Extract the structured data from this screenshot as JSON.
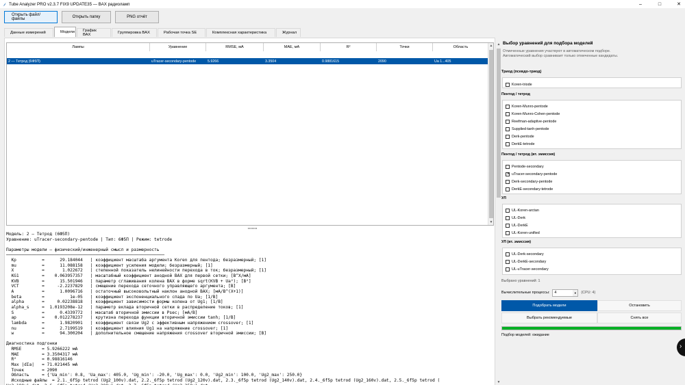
{
  "window": {
    "title": "Tube Analyzer PRO v2.3.7 FIX9 UPDATE35 — ВАХ радиоламп",
    "controls": [
      "–",
      "□",
      "✕"
    ]
  },
  "toolbar": {
    "open_files": "Открыть файл/файлы",
    "open_folder": "Открыть папку",
    "png_report": "PNG отчёт"
  },
  "tabs": [
    "Данные измерений",
    "Модели",
    "График ВАХ",
    "Группировка ВАХ",
    "Рабочая точка SE",
    "Комплексная характеристика",
    "Журнал"
  ],
  "table": {
    "columns": [
      "Лампы",
      "Уравнение",
      "RMSE, мА",
      "MAE, мА",
      "R²",
      "Точки",
      "Область"
    ],
    "rows": [
      [
        "2 — Тетрод (6Ф5П)",
        "uTracer-secondary-pentode",
        "5.9266",
        "3.3504",
        "0.9881615",
        "2090",
        "Ua 1...405"
      ]
    ]
  },
  "details": {
    "lines": [
      "Модель: 2 — Тетрод (6Ф5П)",
      "Уравнение: uTracer-secondary-pentode | Тип: 6Ф5П | Режим: tetrode",
      "",
      "Параметры модели — физический/инженерный смысл и размерность",
      "──────────────────────────────────────────────────────────────",
      "  Kp          =      29.184044   | коэффициент масштаба аргумента Koren для пентода; безразмерный; [1]",
      "  mu          =      11.088158   | коэффициент усиления модели; безразмерный; [1]",
      "  X           =       1.022672   | степенной показатель нелинейности перехода в ток; безразмерный; [1]",
      "  KG1         =    0.063957357   | масштабный коэффициент анодной ВАХ для первой сетки; [B^X/мА]",
      "  KVB         =      15.501946   | параметр сглаживания колена ВАХ в форме sqrt(KVB + Ua²); [B²]",
      "  VCT         =     -2.2237829   | смещение перехода сеточного управляющего аргумента; [B]",
      "  A           =      1.0096716   | остаточный высоковольтный наклон анодной ВАХ; [мА/B^(X+1)]",
      "  beta        =          1e-05   | коэффициент экспоненциального спада по Ua; [1/B]",
      "  alpha       =     0.02238818   | коэффициент зависимости формы колена от Ug1; [1/B]",
      "  alpha_s     =  1.0193208e-12   | параметр вклада вторичной сетки в распределение токов; [1]",
      "  S           =      0.4339772   | масштаб вторичной эмиссии в Psec; [мА/B]",
      "  ap          =    0.012278237   | крутизна перехода функции вторичной эмиссии tanh; [1/B]",
      "  lambda      =      1.9820901   | коэффициент связи Ug2 с эффективным напряжением crossover; [1]",
      "  nu          =      2.7199519   | коэффициент влияния Ug1 на напряжение crossover; [1]",
      "  w           =      94.300204   | дополнительное смещение напряжения crossover вторичной эмиссии; [B]",
      "",
      "Диагностика подгонки",
      "  RMSE        = 5.9266222 мА",
      "  MAE         = 3.3504317 мА",
      "  R²          = 0.98816146",
      "  Max |dIa|   = 71.021445 мА",
      "  Точек       = 2090",
      "  Область     = {'Ua_min': 0.8, 'Ua_max': 405.0, 'Ug_min': -20.0, 'Ug_max': 0.0, 'Ug2_min': 100.0, 'Ug2_max': 250.0}",
      "  Исходные файлы  = 2.1._6f5p tetrod (Ug2_100v).dat, 2.2._6f5p tetrod (Ug2_120v).dat, 2.3._6f5p tetrod (Ug2_140v).dat, 2.4._6f5p tetrod (Ug2_160v).dat, 2.5._6f5p tetrod (",
      "Ug2_180v).dat, 2.6._6f5p tetrod (Ug2_200v).dat, 2.7._6f5p tetrod (Ug2_250v).dat"
    ]
  },
  "right": {
    "title": "Выбор уравнений для подбора моделей",
    "description": "Отмеченные уравнения участвуют в автоматическом подборе. Автоматический выбор сравнивает только отмеченные кандидаты.",
    "groups": [
      {
        "title": "Триод (псевдо-триод)",
        "items": [
          {
            "label": "Koren-triode",
            "checked": false
          }
        ]
      },
      {
        "title": "Пентод / тетрод",
        "items": [
          {
            "label": "Koren-Munro-pentode",
            "checked": false
          },
          {
            "label": "Koren-Munro-Cohen-pentode",
            "checked": false
          },
          {
            "label": "Reefman-adaptive-pentode",
            "checked": false
          },
          {
            "label": "Supplied-tanh-pentode",
            "checked": false
          },
          {
            "label": "Derk-pentode",
            "checked": false
          },
          {
            "label": "DerkE-tetrode",
            "checked": false
          }
        ]
      },
      {
        "title": "Пентод / тетрод (вт. эмиссия)",
        "items": [
          {
            "label": "Pentode-secondary",
            "checked": false
          },
          {
            "label": "uTracer-secondary-pentode",
            "checked": true
          },
          {
            "label": "Derk-secondary-pentode",
            "checked": false
          },
          {
            "label": "DerkE-secondary-tetrode",
            "checked": false
          }
        ]
      },
      {
        "title": "УЛ",
        "items": [
          {
            "label": "UL-Koren-arctan",
            "checked": false
          },
          {
            "label": "UL-Derk",
            "checked": false
          },
          {
            "label": "UL-DerkE",
            "checked": false
          },
          {
            "label": "UL-Koren-unified",
            "checked": false
          }
        ]
      },
      {
        "title": "УЛ (вт. эмиссия)",
        "items": [
          {
            "label": "UL-Derk-secondary",
            "checked": false
          },
          {
            "label": "UL-DerkE-secondary",
            "checked": false
          },
          {
            "label": "UL-uTracer-secondary",
            "checked": false
          }
        ]
      }
    ],
    "chosen": "Выбрано уравнений: 1",
    "processes_label": "Вычислительные процессы:",
    "processes_value": "4",
    "cpu_label": "(CPU: 4)",
    "buttons": {
      "fit": "Подобрать модели",
      "stop": "Остановить",
      "recommended": "Выбрать рекомендуемые",
      "clear_all": "Снять все"
    },
    "progress": 1.0,
    "status": "Подбор моделей: ожидание"
  },
  "colors": {
    "accent": "#0058a8",
    "progress": "#06b025"
  }
}
